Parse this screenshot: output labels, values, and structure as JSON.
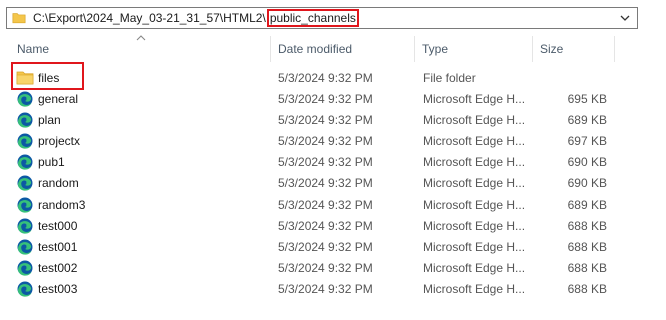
{
  "address": {
    "path_prefix": "C:\\Export\\2024_May_03-21_31_57\\HTML2\\",
    "current_folder": "public_channels"
  },
  "columns": {
    "name": "Name",
    "date": "Date modified",
    "type": "Type",
    "size": "Size"
  },
  "files": [
    {
      "name": "files",
      "date": "5/3/2024 9:32 PM",
      "type": "File folder",
      "size": "",
      "icon": "folder-icon"
    },
    {
      "name": "general",
      "date": "5/3/2024 9:32 PM",
      "type": "Microsoft Edge H...",
      "size": "695 KB",
      "icon": "edge-icon"
    },
    {
      "name": "plan",
      "date": "5/3/2024 9:32 PM",
      "type": "Microsoft Edge H...",
      "size": "689 KB",
      "icon": "edge-icon"
    },
    {
      "name": "projectx",
      "date": "5/3/2024 9:32 PM",
      "type": "Microsoft Edge H...",
      "size": "697 KB",
      "icon": "edge-icon"
    },
    {
      "name": "pub1",
      "date": "5/3/2024 9:32 PM",
      "type": "Microsoft Edge H...",
      "size": "690 KB",
      "icon": "edge-icon"
    },
    {
      "name": "random",
      "date": "5/3/2024 9:32 PM",
      "type": "Microsoft Edge H...",
      "size": "690 KB",
      "icon": "edge-icon"
    },
    {
      "name": "random3",
      "date": "5/3/2024 9:32 PM",
      "type": "Microsoft Edge H...",
      "size": "689 KB",
      "icon": "edge-icon"
    },
    {
      "name": "test000",
      "date": "5/3/2024 9:32 PM",
      "type": "Microsoft Edge H...",
      "size": "688 KB",
      "icon": "edge-icon"
    },
    {
      "name": "test001",
      "date": "5/3/2024 9:32 PM",
      "type": "Microsoft Edge H...",
      "size": "688 KB",
      "icon": "edge-icon"
    },
    {
      "name": "test002",
      "date": "5/3/2024 9:32 PM",
      "type": "Microsoft Edge H...",
      "size": "688 KB",
      "icon": "edge-icon"
    },
    {
      "name": "test003",
      "date": "5/3/2024 9:32 PM",
      "type": "Microsoft Edge H...",
      "size": "688 KB",
      "icon": "edge-icon"
    }
  ],
  "colors": {
    "highlight": "#e0161c",
    "folder": "#f4c64b",
    "edge_blue": "#0c59a4",
    "edge_green": "#36c17a"
  }
}
